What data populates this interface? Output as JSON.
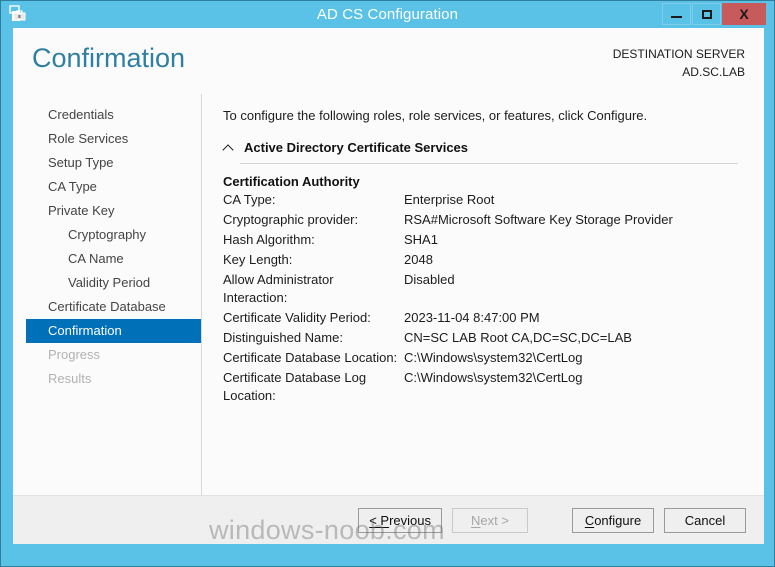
{
  "window": {
    "title": "AD CS Configuration",
    "icon": "server-manager-icon",
    "controls": {
      "minimize_label": "–",
      "maximize_label": "□",
      "close_label": "X"
    }
  },
  "header": {
    "page_title": "Confirmation",
    "destination_label": "DESTINATION SERVER",
    "destination_server": "AD.SC.LAB"
  },
  "sidebar": {
    "items": [
      {
        "label": "Credentials",
        "state": "normal",
        "indent": false
      },
      {
        "label": "Role Services",
        "state": "normal",
        "indent": false
      },
      {
        "label": "Setup Type",
        "state": "normal",
        "indent": false
      },
      {
        "label": "CA Type",
        "state": "normal",
        "indent": false
      },
      {
        "label": "Private Key",
        "state": "normal",
        "indent": false
      },
      {
        "label": "Cryptography",
        "state": "normal",
        "indent": true
      },
      {
        "label": "CA Name",
        "state": "normal",
        "indent": true
      },
      {
        "label": "Validity Period",
        "state": "normal",
        "indent": true
      },
      {
        "label": "Certificate Database",
        "state": "normal",
        "indent": false
      },
      {
        "label": "Confirmation",
        "state": "selected",
        "indent": false
      },
      {
        "label": "Progress",
        "state": "disabled",
        "indent": false
      },
      {
        "label": "Results",
        "state": "disabled",
        "indent": false
      }
    ]
  },
  "content": {
    "intro": "To configure the following roles, role services, or features, click Configure.",
    "section": {
      "collapse_icon": "chevron-up-icon",
      "title": "Active Directory Certificate Services"
    },
    "group_title": "Certification Authority",
    "details": [
      {
        "key": "CA Type:",
        "value": "Enterprise Root"
      },
      {
        "key": "Cryptographic provider:",
        "value": "RSA#Microsoft Software Key Storage Provider"
      },
      {
        "key": "Hash Algorithm:",
        "value": "SHA1"
      },
      {
        "key": "Key Length:",
        "value": "2048"
      },
      {
        "key": "Allow Administrator Interaction:",
        "value": "Disabled"
      },
      {
        "key": "Certificate Validity Period:",
        "value": "2023-11-04 8:47:00 PM"
      },
      {
        "key": "Distinguished Name:",
        "value": "CN=SC LAB Root CA,DC=SC,DC=LAB"
      },
      {
        "key": "Certificate Database Location:",
        "value": "C:\\Windows\\system32\\CertLog"
      },
      {
        "key": "Certificate Database Log Location:",
        "value": "C:\\Windows\\system32\\CertLog"
      }
    ]
  },
  "footer": {
    "previous_label": "< Previous",
    "next_label": "Next >",
    "configure_label": "Configure",
    "cancel_label": "Cancel",
    "next_enabled": false,
    "watermark": "windows-noob.com"
  },
  "colors": {
    "frame_blue": "#5bc2e7",
    "accent_title": "#2f7fa3",
    "selection_blue": "#0071b9",
    "close_red": "#c75b5b",
    "client_bg": "#fbfbfb",
    "footer_bg": "#efefef"
  }
}
